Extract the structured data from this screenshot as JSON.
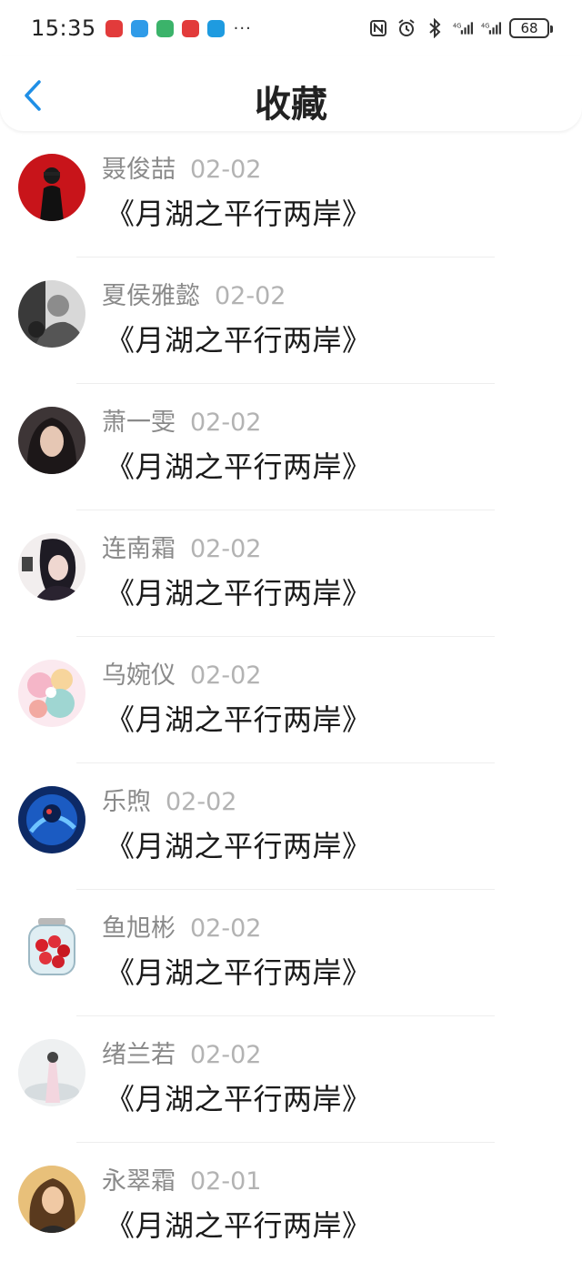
{
  "status_bar": {
    "time": "15:35",
    "more": "···",
    "battery": "68"
  },
  "header": {
    "title": "收藏",
    "back_icon": "chevron-left-icon"
  },
  "colors": {
    "accent": "#1f8fe6",
    "name_text": "#8a8a8a",
    "date_text": "#b3b3b3"
  },
  "favorites": [
    {
      "name": "聂俊喆",
      "date": "02-02",
      "title": "《月湖之平行两岸》"
    },
    {
      "name": "夏侯雅懿",
      "date": "02-02",
      "title": "《月湖之平行两岸》"
    },
    {
      "name": "萧一雯",
      "date": "02-02",
      "title": "《月湖之平行两岸》"
    },
    {
      "name": "连南霜",
      "date": "02-02",
      "title": "《月湖之平行两岸》"
    },
    {
      "name": "乌婉仪",
      "date": "02-02",
      "title": "《月湖之平行两岸》"
    },
    {
      "name": "乐煦",
      "date": "02-02",
      "title": "《月湖之平行两岸》"
    },
    {
      "name": "鱼旭彬",
      "date": "02-02",
      "title": "《月湖之平行两岸》"
    },
    {
      "name": "绪兰若",
      "date": "02-02",
      "title": "《月湖之平行两岸》"
    },
    {
      "name": "永翠霜",
      "date": "02-01",
      "title": "《月湖之平行两岸》"
    }
  ]
}
